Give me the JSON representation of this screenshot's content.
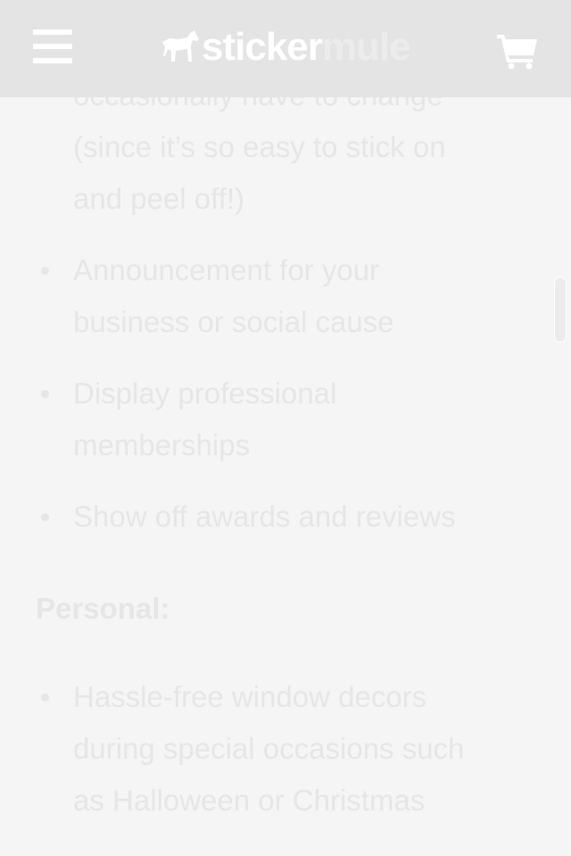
{
  "header": {
    "logo_part1": "sticker",
    "logo_part2": "mule"
  },
  "content": {
    "continued_item": {
      "line0": "occasionally have to change",
      "line1": "(since it’s so easy to stick on",
      "line2": "and peel off!)"
    },
    "business_items": [
      {
        "lines": [
          "Announcement for your",
          "business or social cause"
        ]
      },
      {
        "lines": [
          "Display professional",
          "memberships"
        ]
      },
      {
        "lines": [
          "Show off awards and reviews"
        ]
      }
    ],
    "personal_heading": "Personal:",
    "personal_items": [
      {
        "lines": [
          "Hassle-free window decors",
          "during special occasions such",
          "as Halloween or Christmas"
        ]
      }
    ]
  },
  "colors": {
    "header_bg": "#e4e4e4",
    "page_bg": "#f5f5f5",
    "text": "#e6e6e6"
  }
}
